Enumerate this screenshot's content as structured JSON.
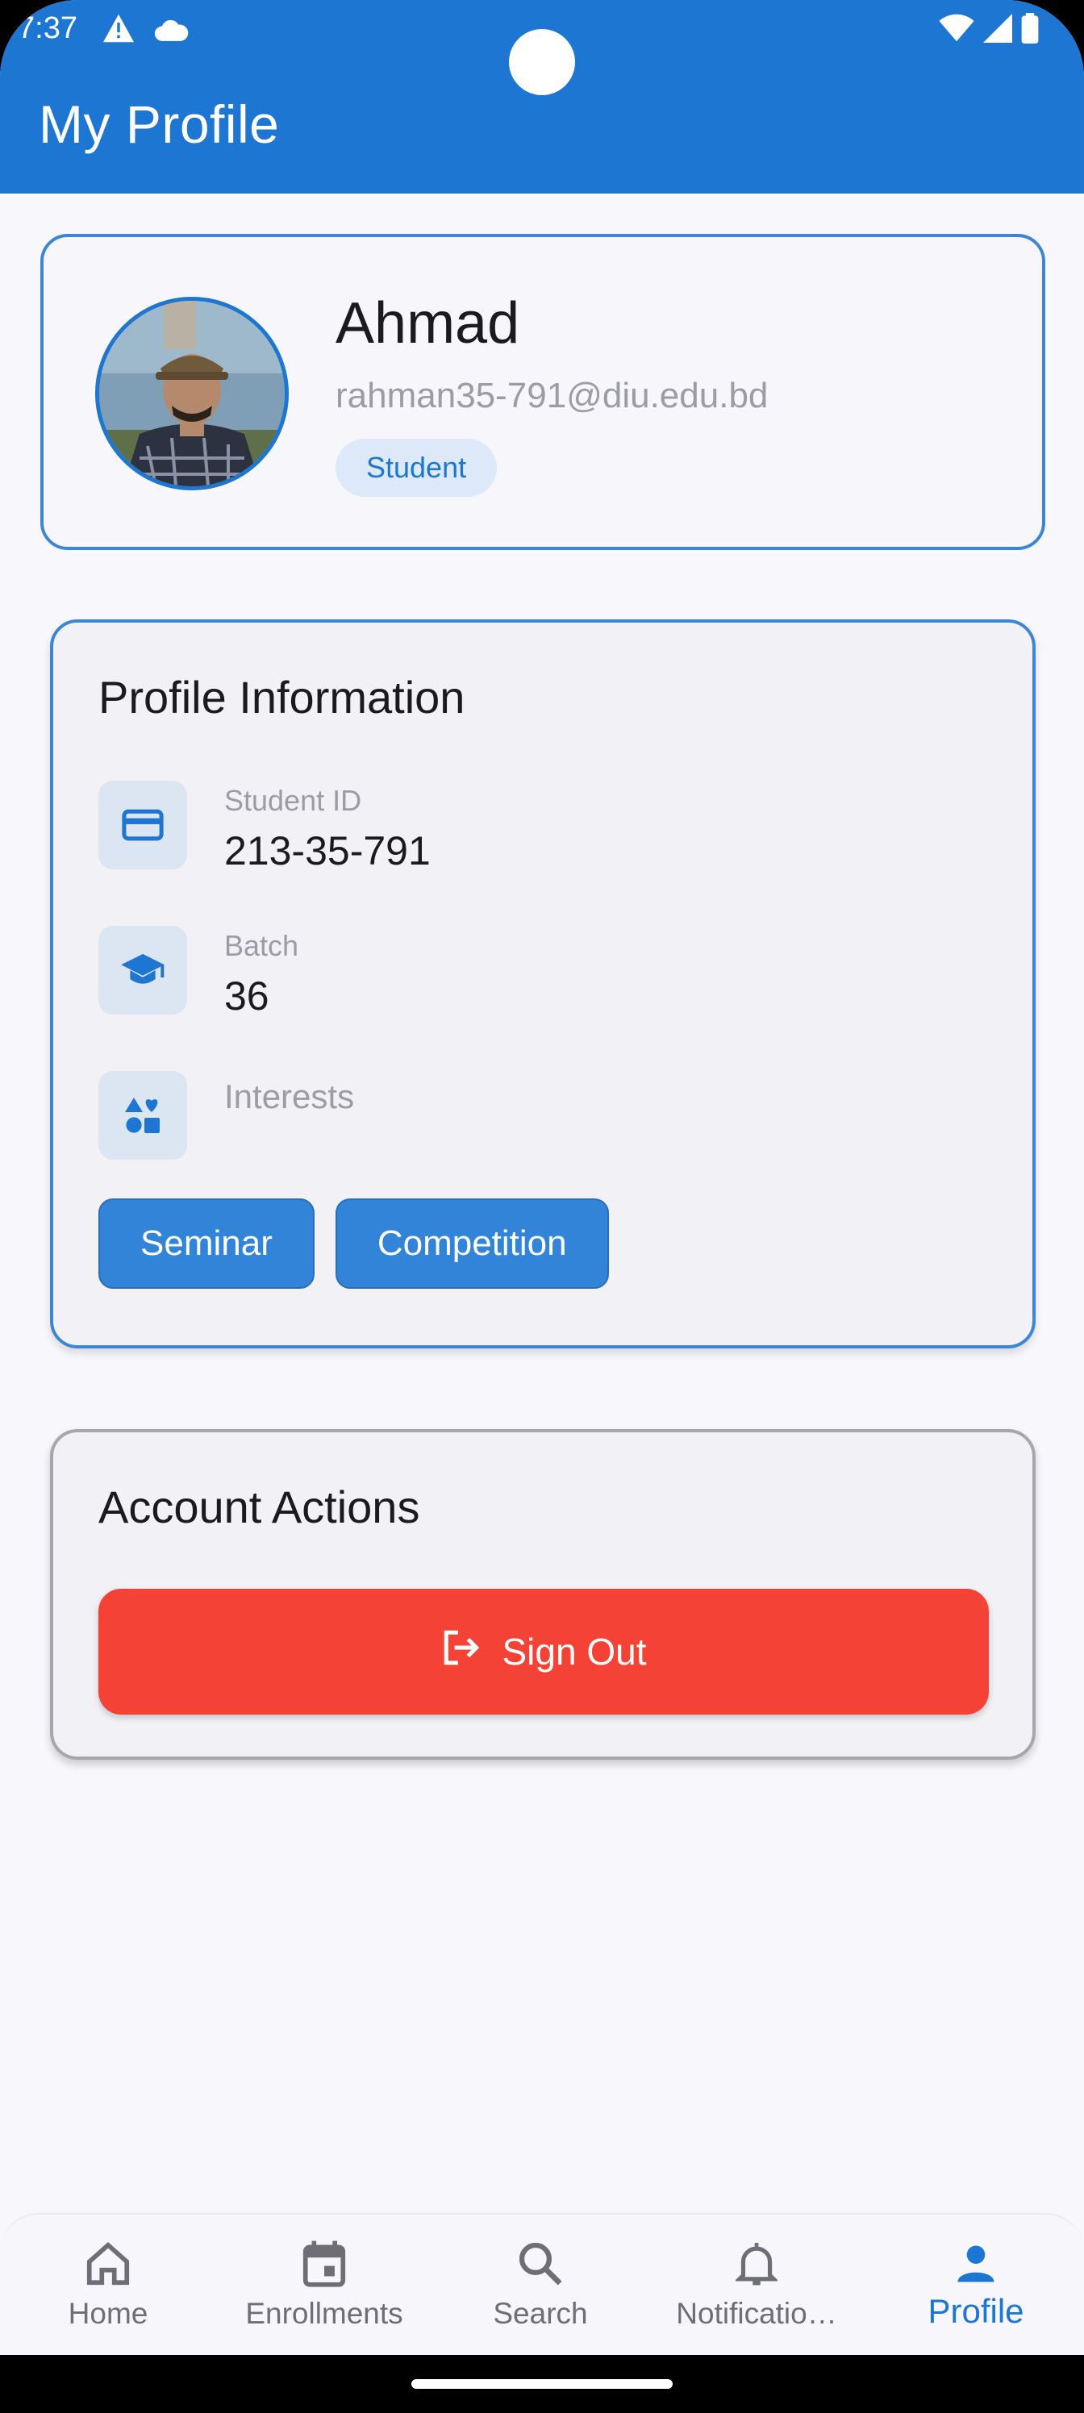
{
  "status_bar": {
    "time": "7:37",
    "icons": [
      "warning-icon",
      "cloud-icon",
      "wifi-icon",
      "signal-icon",
      "battery-icon"
    ]
  },
  "app_bar": {
    "title": "My Profile",
    "color": "#1c76d2"
  },
  "profile": {
    "name": "Ahmad",
    "email": "rahman35-791@diu.edu.bd",
    "role": "Student"
  },
  "profile_info": {
    "title": "Profile Information",
    "rows": [
      {
        "icon": "id-card-icon",
        "label": "Student ID",
        "value": "213-35-791"
      },
      {
        "icon": "graduation-cap-icon",
        "label": "Batch",
        "value": "36"
      },
      {
        "icon": "interests-icon",
        "label": "Interests",
        "value": ""
      }
    ],
    "interests": [
      "Seminar",
      "Competition"
    ]
  },
  "account_actions": {
    "title": "Account Actions",
    "signout_label": "Sign Out",
    "signout_color": "#f44336"
  },
  "bottom_nav": {
    "items": [
      {
        "label": "Home",
        "icon": "home-icon",
        "active": false
      },
      {
        "label": "Enrollments",
        "icon": "calendar-icon",
        "active": false
      },
      {
        "label": "Search",
        "icon": "search-icon",
        "active": false
      },
      {
        "label": "Notificatio…",
        "icon": "bell-icon",
        "active": false
      },
      {
        "label": "Profile",
        "icon": "person-icon",
        "active": true
      }
    ],
    "active_color": "#1c76d2"
  }
}
